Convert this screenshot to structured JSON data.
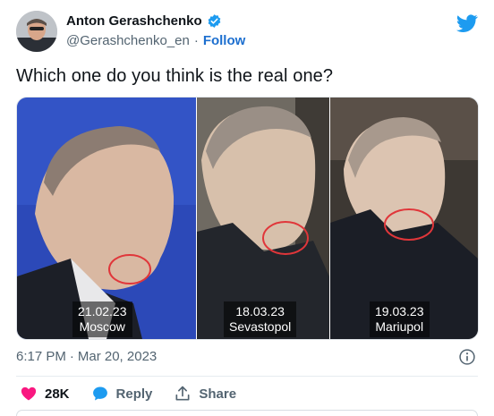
{
  "tweet": {
    "author_name": "Anton Gerashchenko",
    "handle": "@Gerashchenko_en",
    "separator": "·",
    "follow_label": "Follow",
    "text": "Which one do you think is the real one?",
    "time": "6:17 PM",
    "date": "Mar 20, 2023"
  },
  "media": {
    "panels": [
      {
        "date": "21.02.23",
        "place": "Moscow"
      },
      {
        "date": "18.03.23",
        "place": "Sevastopol"
      },
      {
        "date": "19.03.23",
        "place": "Mariupol"
      }
    ]
  },
  "actions": {
    "likes": "28K",
    "reply_label": "Reply",
    "share_label": "Share"
  },
  "colors": {
    "accent": "#1d9bf0",
    "like": "#f91880",
    "reply": "#1d9bf0",
    "circle": "#e0363a"
  },
  "icons": [
    "verified-badge-icon",
    "twitter-bird-icon",
    "info-icon",
    "heart-icon",
    "reply-bubble-icon",
    "share-icon"
  ]
}
